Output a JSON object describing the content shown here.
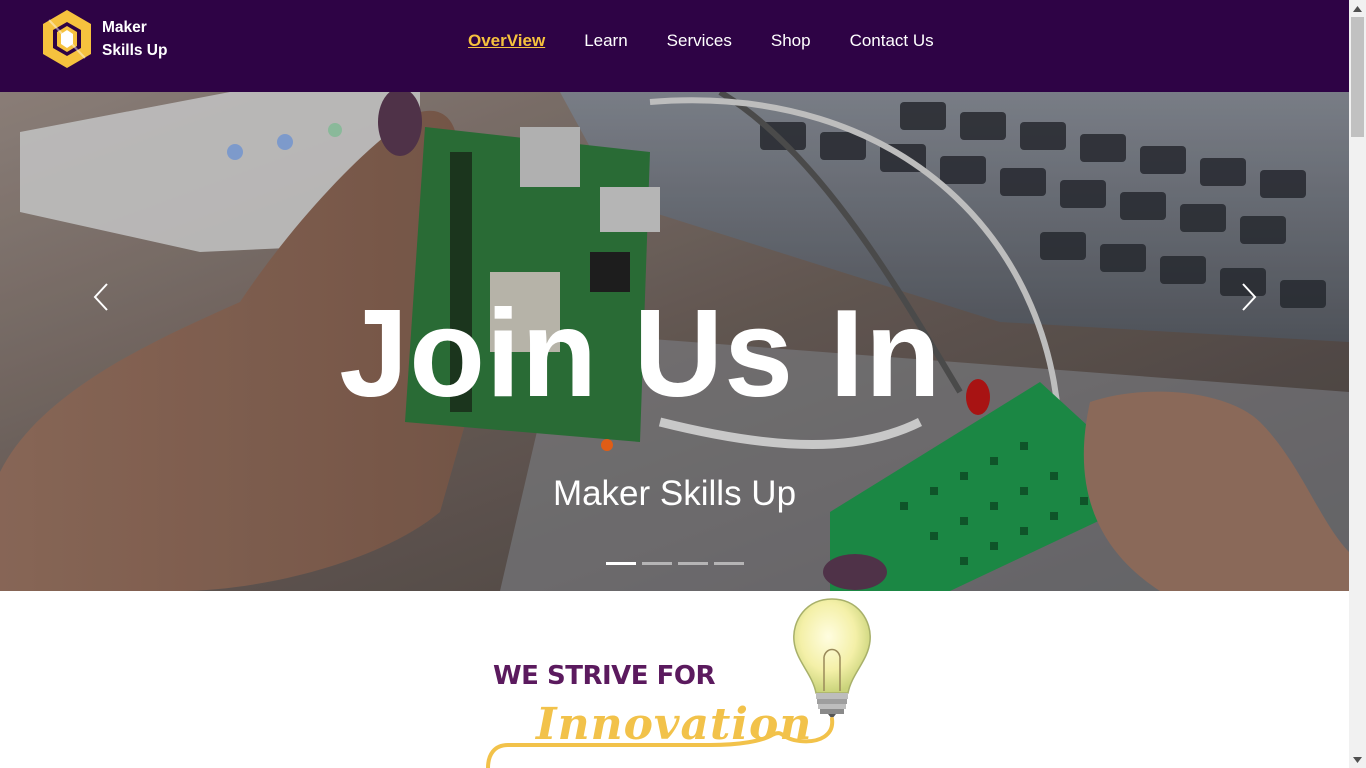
{
  "brand": {
    "name_line1": "Maker",
    "name_line2": "Skills Up",
    "logo_icon": "hexagon-logo-icon"
  },
  "nav": {
    "items": [
      {
        "label": "OverView",
        "active": true
      },
      {
        "label": "Learn",
        "active": false
      },
      {
        "label": "Services",
        "active": false
      },
      {
        "label": "Shop",
        "active": false
      },
      {
        "label": "Contact Us",
        "active": false
      }
    ]
  },
  "hero": {
    "title": "Join Us In",
    "subtitle": "Maker Skills Up",
    "prev_icon": "chevron-left-icon",
    "next_icon": "chevron-right-icon",
    "slides_count": 4,
    "active_slide": 0
  },
  "section": {
    "tagline": "WE STRIVE FOR",
    "highlight": "Innovation",
    "icon": "lightbulb-icon"
  },
  "colors": {
    "navbar_bg": "#2e0345",
    "accent": "#f6c23e",
    "tagline_purple": "#5b1a5e",
    "highlight_yellow": "#f2c24a"
  }
}
